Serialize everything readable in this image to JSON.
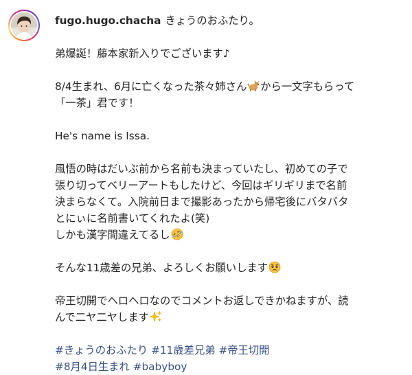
{
  "post": {
    "username": "fugo.hugo.chacha",
    "title": "きょうのおふたり。",
    "line_announce": "弟爆誕！藤本家新入りでございます♪",
    "line_born_1a": "8/4生まれ、6月に亡くなった茶々姉さん",
    "line_born_1b": "から一文字もらって",
    "line_born_2": "「一茶」君です！",
    "line_english": "He's name is Issa.",
    "line_story_1": "風悟の時はだいぶ前から名前も決まっていたし、初めての子で",
    "line_story_2": "張り切ってベリーアートもしたけど、今回はギリギリまで名前",
    "line_story_3": "決まらなくて。入院前日まで撮影あったから帰宅後にバタバタ",
    "line_story_4": "とにぃに名前書いてくれたよ(笑)",
    "line_story_5": "しかも漢字間違えてるし",
    "line_regards": "そんな11歳差の兄弟、よろしくお願いします",
    "line_reply_1": "帝王切開でヘロヘロなのでコメントお返しできかねますが、読",
    "line_reply_2": "んで二ヤ二ヤします",
    "hashtags_row1": [
      "#きょうのおふたり",
      "#11歳差兄弟",
      "#帝王切開"
    ],
    "hashtags_row2": [
      "#8月4日生まれ",
      "#babyboy"
    ]
  },
  "icons": {
    "avatar": "profile-photo",
    "dog": "dog-emoji",
    "laugh": "rolling-laughing-emoji",
    "pleading": "pleading-face-emoji",
    "sparkles": "sparkles-emoji"
  },
  "colors": {
    "text": "#262626",
    "hashtag": "#385185",
    "ring_start": "#f58529",
    "ring_end": "#dd2a7b"
  }
}
